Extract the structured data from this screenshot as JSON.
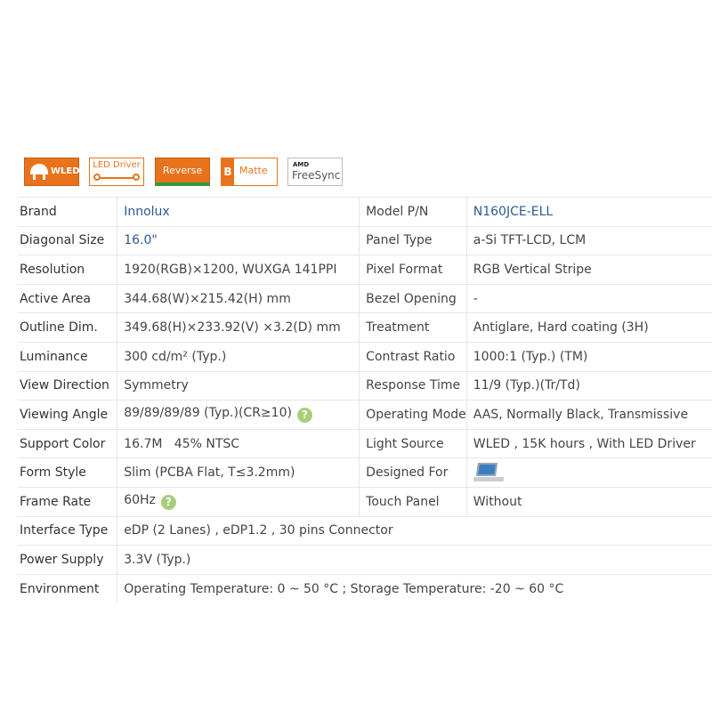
{
  "badges": {
    "wled": "WLED",
    "led_driver": "LED Driver",
    "reverse": "Reverse",
    "matte_letter": "B",
    "matte": "Matte",
    "amd": "AMD",
    "freesync": "FreeSync"
  },
  "specs": {
    "brand": {
      "label": "Brand",
      "value": "Innolux"
    },
    "model": {
      "label": "Model P/N",
      "value": "N160JCE-ELL"
    },
    "diagonal": {
      "label": "Diagonal Size",
      "value": "16.0\""
    },
    "panel_type": {
      "label": "Panel Type",
      "value": "a-Si TFT-LCD, LCM"
    },
    "resolution": {
      "label": "Resolution",
      "value": "1920(RGB)×1200, WUXGA  141PPI"
    },
    "pixel_format": {
      "label": "Pixel Format",
      "value": "RGB Vertical Stripe"
    },
    "active_area": {
      "label": "Active Area",
      "value": "344.68(W)×215.42(H) mm"
    },
    "bezel": {
      "label": "Bezel Opening",
      "value": "-"
    },
    "outline": {
      "label": "Outline Dim.",
      "value": "349.68(H)×233.92(V) ×3.2(D) mm"
    },
    "treatment": {
      "label": "Treatment",
      "value": "Antiglare, Hard coating (3H)"
    },
    "luminance": {
      "label": "Luminance",
      "value": "300 cd/m² (Typ.)"
    },
    "contrast": {
      "label": "Contrast Ratio",
      "value": "1000:1 (Typ.) (TM)"
    },
    "view_direction": {
      "label": "View Direction",
      "value": "Symmetry"
    },
    "response": {
      "label": "Response Time",
      "value": "11/9 (Typ.)(Tr/Td)"
    },
    "viewing_angle": {
      "label": "Viewing Angle",
      "value": "89/89/89/89 (Typ.)(CR≥10)"
    },
    "operating_mode": {
      "label": "Operating Mode",
      "value": "AAS, Normally Black, Transmissive"
    },
    "support_color": {
      "label": "Support Color",
      "value": "16.7M   45% NTSC"
    },
    "light_source": {
      "label": "Light Source",
      "value": "WLED , 15K hours , With LED Driver"
    },
    "form_style": {
      "label": "Form Style",
      "value": "Slim (PCBA Flat, T≤3.2mm)"
    },
    "designed_for": {
      "label": "Designed For",
      "icon": "laptop-icon"
    },
    "frame_rate": {
      "label": "Frame Rate",
      "value": "60Hz"
    },
    "touch_panel": {
      "label": "Touch Panel",
      "value": "Without"
    },
    "interface": {
      "label": "Interface Type",
      "value": "eDP (2 Lanes) , eDP1.2 , 30 pins Connector"
    },
    "power": {
      "label": "Power Supply",
      "value": "3.3V (Typ.)"
    },
    "environment": {
      "label": "Environment",
      "value": "Operating Temperature: 0 ~ 50 °C ; Storage Temperature: -20 ~ 60 °C"
    }
  },
  "help_icon_glyph": "?",
  "colors": {
    "accent": "#e8731c",
    "link": "#2b5b93",
    "help": "#a6cf7b"
  }
}
